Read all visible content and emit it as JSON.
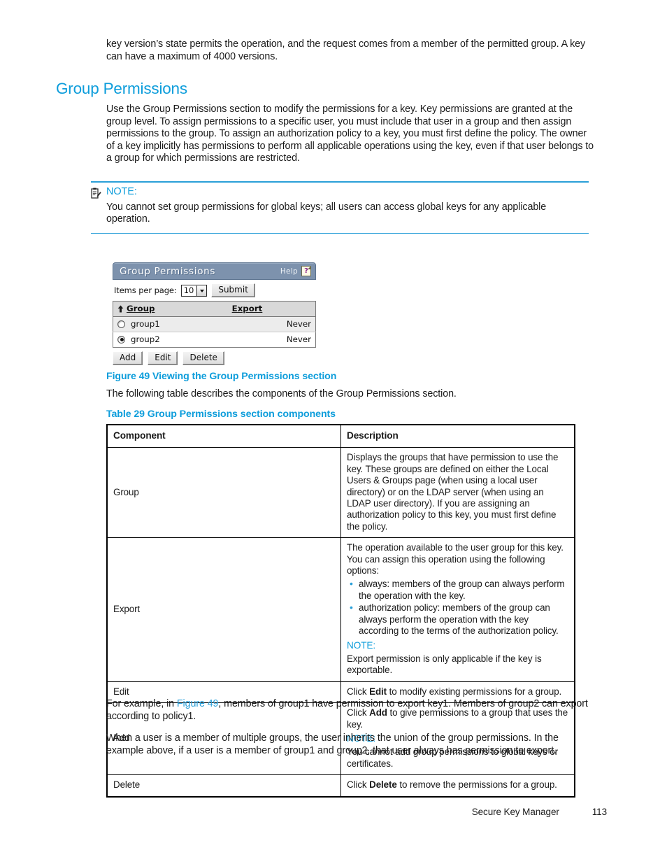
{
  "document": {
    "intro_paragraph": "key version’s state permits the operation, and the request comes from a member of the permitted group. A key can have a maximum of 4000 versions.",
    "section_title": "Group Permissions",
    "section_paragraph": "Use the Group Permissions section to modify the permissions for a key. Key permissions are granted at the group level. To assign permissions to a specific user, you must include that user in a group and then assign permissions to the group. To assign an authorization policy to a key, you must first define the policy. The owner of a key implicitly has permissions to perform all applicable operations using the key, even if that user belongs to a group for which permissions are restricted."
  },
  "note": {
    "icon": "note-clipboard-icon",
    "label": "NOTE:",
    "body": "You cannot set group permissions for global keys; all users can access global keys for any applicable operation."
  },
  "screenshot": {
    "title": "Group Permissions",
    "help_label": "Help",
    "help_icon": "help-question-icon",
    "items_per_page_label": "Items per page:",
    "items_per_page_value": "10",
    "submit_label": "Submit",
    "columns": [
      "Group",
      "Export"
    ],
    "sort_icon": "sort-ascending-arrow-icon",
    "rows": [
      {
        "selected": false,
        "group": "group1",
        "export": "Never"
      },
      {
        "selected": true,
        "group": "group2",
        "export": "Never"
      }
    ],
    "buttons": [
      "Add",
      "Edit",
      "Delete"
    ],
    "colors": {
      "titlebar": "#7d92ad",
      "header_row": "#d9d9d9",
      "row_alt": "#ececec"
    }
  },
  "figure": {
    "caption": "Figure 49 Viewing the Group Permissions section",
    "lead_in": "The following table describes the components of the Group Permissions section."
  },
  "table": {
    "caption": "Table 29 Group Permissions section components",
    "headers": [
      "Component",
      "Description"
    ],
    "rows": {
      "group": {
        "component": "Group",
        "description": "Displays the groups that have permission to use the key. These groups are defined on either the Local Users & Groups page (when using a local user directory) or on the LDAP server (when using an LDAP user directory). If you are assigning an authorization policy to this key, you must first define the policy."
      },
      "export": {
        "component": "Export",
        "lead": "The operation available to the user group for this key. You can assign this operation using the following options:",
        "options": [
          "always: members of the group can always perform the operation with the key.",
          "authorization policy: members of the group can always perform the operation with the key according to the terms of the authorization policy."
        ],
        "note_label": "NOTE:",
        "note_body": "Export permission is only applicable if the key is exportable."
      },
      "edit": {
        "component": "Edit",
        "prefix": "Click ",
        "bold": "Edit",
        "suffix": " to modify existing permissions for a group."
      },
      "add": {
        "component": "Add",
        "prefix": "Click ",
        "bold": "Add",
        "suffix": " to give permissions to a group that uses the key.",
        "note_label": "NOTE:",
        "note_body": "You cannot add group permissions to global keys or certificates."
      },
      "delete": {
        "component": "Delete",
        "prefix": "Click ",
        "bold": "Delete",
        "suffix": " to remove the permissions for a group."
      }
    }
  },
  "closing": {
    "p1_before": "For example, in ",
    "p1_link": "Figure 49",
    "p1_after": ", members of group1 have permission to export key1. Members of group2 can export according to policy1.",
    "p2": "When a user is a member of multiple groups, the user inherits the union of the group permissions. In the example above, if a user is a member of group1 and group2, that user always has permission to export."
  },
  "footer": {
    "title": "Secure Key Manager",
    "page_number": "113"
  }
}
